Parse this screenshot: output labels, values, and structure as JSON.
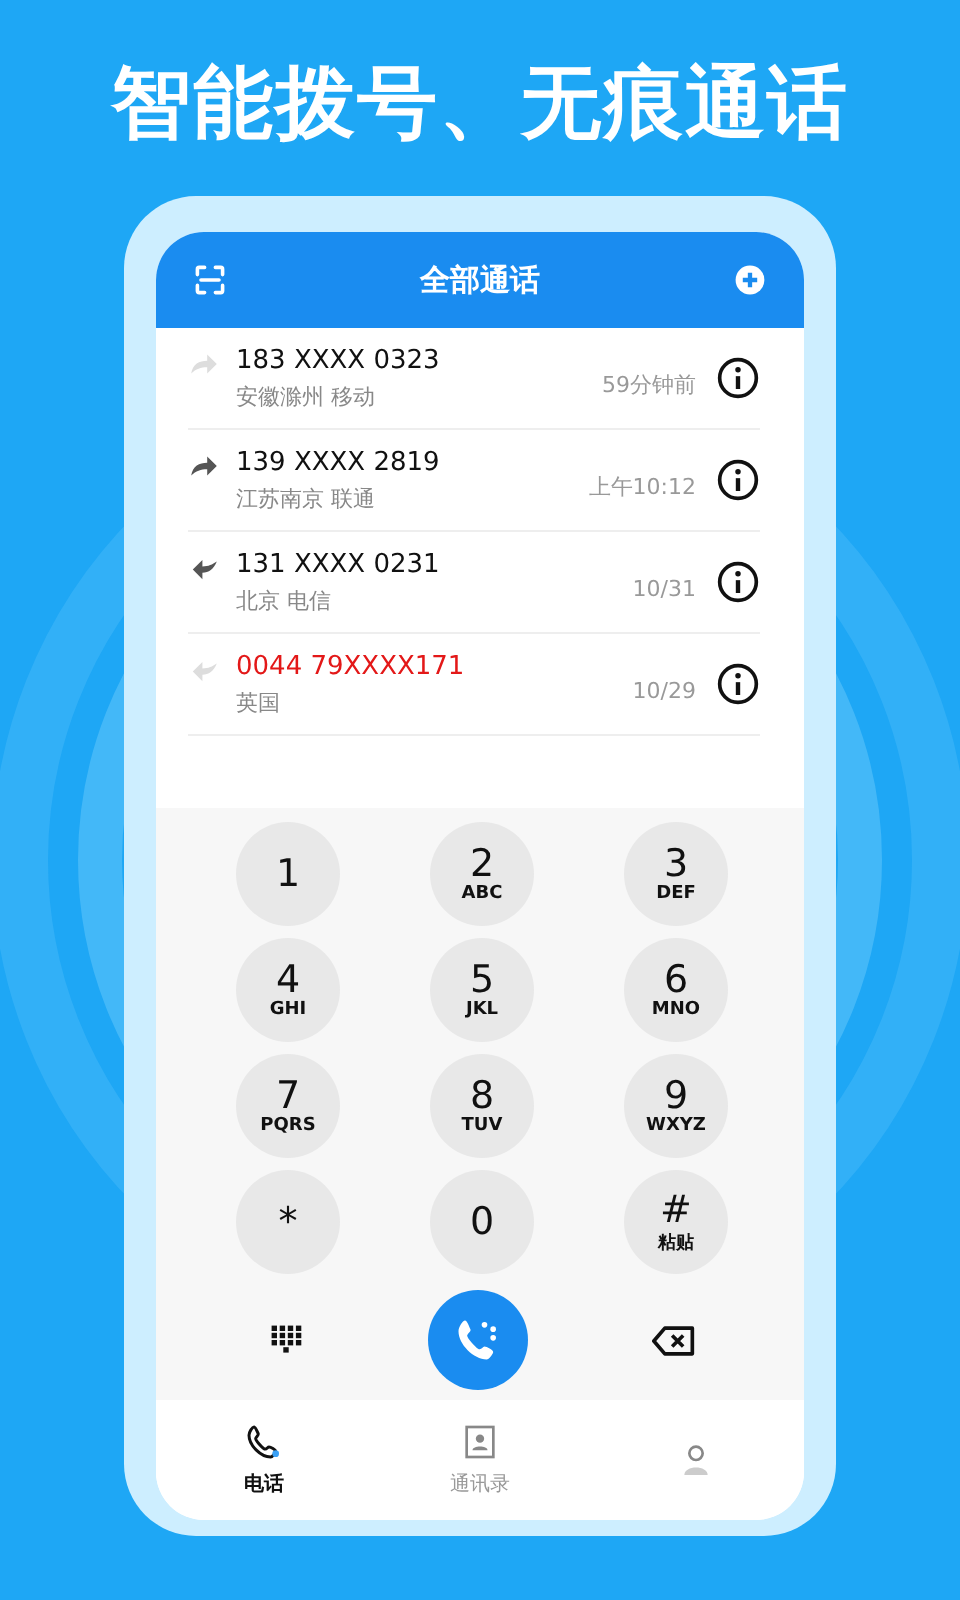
{
  "headline": "智能拨号、无痕通话",
  "header": {
    "title": "全部通话"
  },
  "calls": [
    {
      "number": "183 XXXX 0323",
      "location": "安徽滁州 移动",
      "time": "59分钟前",
      "kind": "outgoing",
      "answered": false,
      "missed": false
    },
    {
      "number": "139 XXXX 2819",
      "location": "江苏南京 联通",
      "time": "上午10:12",
      "kind": "outgoing",
      "answered": true,
      "missed": false
    },
    {
      "number": "131 XXXX 0231",
      "location": "北京 电信",
      "time": "10/31",
      "kind": "incoming",
      "answered": true,
      "missed": false
    },
    {
      "number": "0044 79XXXX171",
      "location": "英国",
      "time": "10/29",
      "kind": "incoming",
      "answered": false,
      "missed": true
    }
  ],
  "keys": [
    {
      "digit": "1"
    },
    {
      "digit": "2",
      "letters": "ABC"
    },
    {
      "digit": "3",
      "letters": "DEF"
    },
    {
      "digit": "4",
      "letters": "GHI"
    },
    {
      "digit": "5",
      "letters": "JKL"
    },
    {
      "digit": "6",
      "letters": "MNO"
    },
    {
      "digit": "7",
      "letters": "PQRS"
    },
    {
      "digit": "8",
      "letters": "TUV"
    },
    {
      "digit": "9",
      "letters": "WXYZ"
    },
    {
      "digit": "*"
    },
    {
      "digit": "0"
    },
    {
      "digit": "#",
      "letters": "粘贴"
    }
  ],
  "tabs": [
    {
      "kind": "phone",
      "label": "电话",
      "selected": true
    },
    {
      "kind": "contacts",
      "label": "通讯录",
      "selected": false
    },
    {
      "kind": "profile",
      "selected": false
    }
  ]
}
